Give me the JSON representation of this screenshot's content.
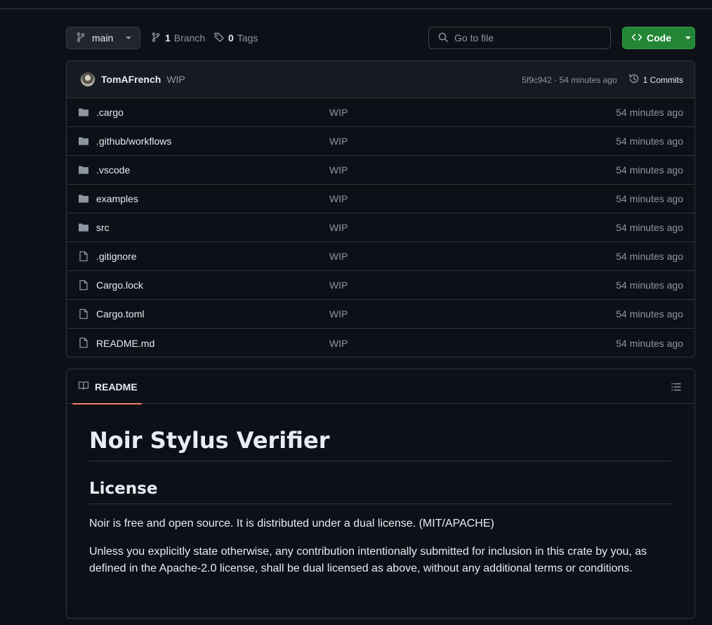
{
  "toolbar": {
    "branch_name": "main",
    "branch_count": "1",
    "branch_label": "Branch",
    "tag_count": "0",
    "tag_label": "Tags",
    "search_placeholder": "Go to file",
    "code_label": "Code"
  },
  "latest_commit": {
    "author": "TomAFrench",
    "message": "WIP",
    "sha_time": "5f9c942 · 54 minutes ago",
    "commits_label": "1 Commits"
  },
  "files": [
    {
      "type": "folder",
      "name": ".cargo",
      "message": "WIP",
      "age": "54 minutes ago"
    },
    {
      "type": "folder",
      "name": ".github/workflows",
      "message": "WIP",
      "age": "54 minutes ago"
    },
    {
      "type": "folder",
      "name": ".vscode",
      "message": "WIP",
      "age": "54 minutes ago"
    },
    {
      "type": "folder",
      "name": "examples",
      "message": "WIP",
      "age": "54 minutes ago"
    },
    {
      "type": "folder",
      "name": "src",
      "message": "WIP",
      "age": "54 minutes ago"
    },
    {
      "type": "file",
      "name": ".gitignore",
      "message": "WIP",
      "age": "54 minutes ago"
    },
    {
      "type": "file",
      "name": "Cargo.lock",
      "message": "WIP",
      "age": "54 minutes ago"
    },
    {
      "type": "file",
      "name": "Cargo.toml",
      "message": "WIP",
      "age": "54 minutes ago"
    },
    {
      "type": "file",
      "name": "README.md",
      "message": "WIP",
      "age": "54 minutes ago"
    }
  ],
  "readme": {
    "tab_label": "README",
    "title": "Noir Stylus Verifier",
    "section_heading": "License",
    "paragraph_1": "Noir is free and open source. It is distributed under a dual license. (MIT/APACHE)",
    "paragraph_2": "Unless you explicitly state otherwise, any contribution intentionally submitted for inclusion in this crate by you, as defined in the Apache-2.0 license, shall be dual licensed as above, without any additional terms or conditions."
  },
  "colors": {
    "background": "#0d1117",
    "border": "#30363d",
    "primary_button": "#238636",
    "tab_underline": "#f78166",
    "muted_text": "#8d96a0"
  }
}
